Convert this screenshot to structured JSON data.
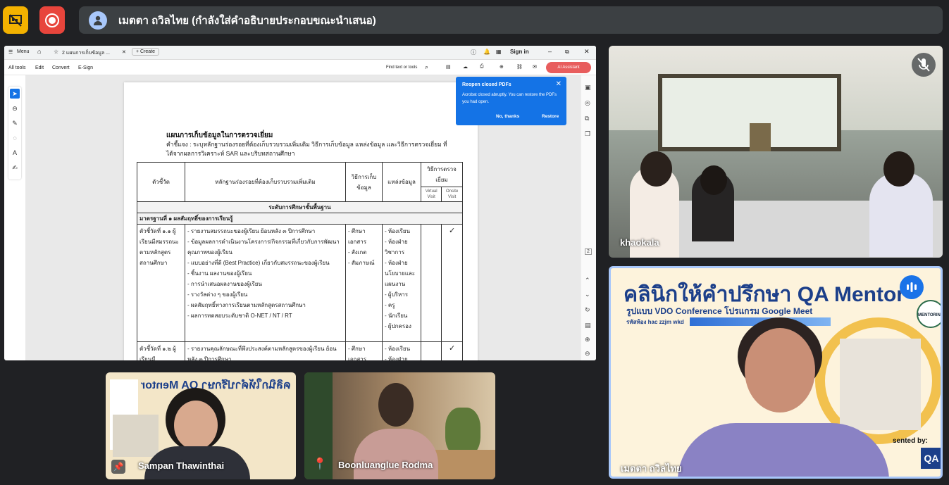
{
  "presenter": {
    "name": "เมตตา ถวิลไทย (กำลังใส่คำอธิบายประกอบขณะนำเสนอ)"
  },
  "colors": {
    "accent_yellow": "#f3b200",
    "record_red": "#e8453c",
    "dark_bg": "#202124",
    "acrobat_blue": "#1473e6"
  },
  "browser": {
    "menu": "Menu",
    "tab_title": "2 แผนการเก็บข้อมูล ...",
    "new_tab": "+ Create",
    "sign_in": "Sign in"
  },
  "acrobat": {
    "menu": [
      "All tools",
      "Edit",
      "Convert",
      "E-Sign"
    ],
    "find": "Find text or tools",
    "ai_button": "AI Assistant",
    "page_number": "2"
  },
  "popup": {
    "title": "Reopen closed PDFs",
    "body": "Acrobat closed abruptly. You can restore the PDFs you had open.",
    "no_thanks": "No, thanks",
    "restore": "Restore"
  },
  "document": {
    "heading": "แผนการเก็บข้อมูลในการตรวจเยี่ยม",
    "instruction": "คำชี้แจง : ระบุหลักฐานร่องรอยที่ต้องเก็บรวบรวมเพิ่มเติม วิธีการเก็บข้อมูล แหล่งข้อมูล และวิธีการตรวจเยี่ยม ที่ได้จากผลการวิเคราะห์ SAR และบริบทสถานศึกษา",
    "headers": {
      "indicator": "ตัวชี้วัด",
      "evidence": "หลักฐานร่องรอยที่ต้องเก็บรวบรวมเพิ่มเติม",
      "method": "วิธีการเก็บข้อมูล",
      "source": "แหล่งข้อมูล",
      "visit": "วิธีการตรวจเยี่ยม",
      "virtual": "Virtual Visit",
      "onsite": "Onsite Visit"
    },
    "level": "ระดับการศึกษาขั้นพื้นฐาน",
    "standard": "มาตรฐานที่ ๑ ผลสัมฤทธิ์ของการเรียนรู้",
    "rows": [
      {
        "indicator": "ตัวชี้วัดที่ ๑.๑ ผู้เรียนมีสมรรถนะตามหลักสูตรสถานศึกษา",
        "evidence": [
          "- รายงานสมรรถนะของผู้เรียน ย้อนหลัง ๓ ปีการศึกษา",
          "- ข้อมูลผลการดำเนินงานโครงการ/กิจกรรมที่เกี่ยวกับการพัฒนาคุณภาพของผู้เรียน",
          "- แบบอย่างที่ดี (Best Practice) เกี่ยวกับสมรรถนะของผู้เรียน",
          "- ชิ้นงาน ผลงานของผู้เรียน",
          "- การนำเสนอผลงานของผู้เรียน",
          "- รางวัลต่าง ๆ ของผู้เรียน",
          "- ผลสัมฤทธิ์ทางการเรียนตามหลักสูตรสถานศึกษา",
          "- ผลการทดสอบระดับชาติ O-NET / NT / RT"
        ],
        "method": [
          "- ศึกษาเอกสาร",
          "- สังเกต",
          "- สัมภาษณ์"
        ],
        "source": [
          "- ห้องเรียน",
          "- ห้องฝ่ายวิชาการ",
          "- ห้องฝ่ายนโยบายและแผนงาน",
          "- ผู้บริหาร",
          "- ครู",
          "- นักเรียน",
          "- ผู้ปกครอง"
        ],
        "check": "✓"
      },
      {
        "indicator": "ตัวชี้วัดที่ ๑.๒ ผู้เรียนมี",
        "evidence": [
          "- รายงานคุณลักษณะที่พึงประสงค์ตามหลักสูตรของผู้เรียน ย้อนหลัง ๓ ปีการศึกษา"
        ],
        "method": [
          "- ศึกษาเอกสาร"
        ],
        "source": [
          "- ห้องเรียน",
          "- ห้องฝ่าย"
        ],
        "check": "✓"
      }
    ]
  },
  "participants": {
    "khaokala": "khaokala",
    "metta": "เมตตา ถวิลไทย",
    "sampan": "Sampan Thawinthai",
    "boon": "Boonluanglue Rodma"
  },
  "banner": {
    "title": "คลินิกให้คำปรึกษา QA Mentor",
    "subtitle": "รูปแบบ VDO Conference โปรแกรม Google Meet",
    "room": "รหัสห้อง hac zzjm wkd",
    "mirrored_title": "คลินิกให้คำปรึกษา QA Mentor",
    "presented_by": "sented by:",
    "mentoring": "MENTORING"
  }
}
